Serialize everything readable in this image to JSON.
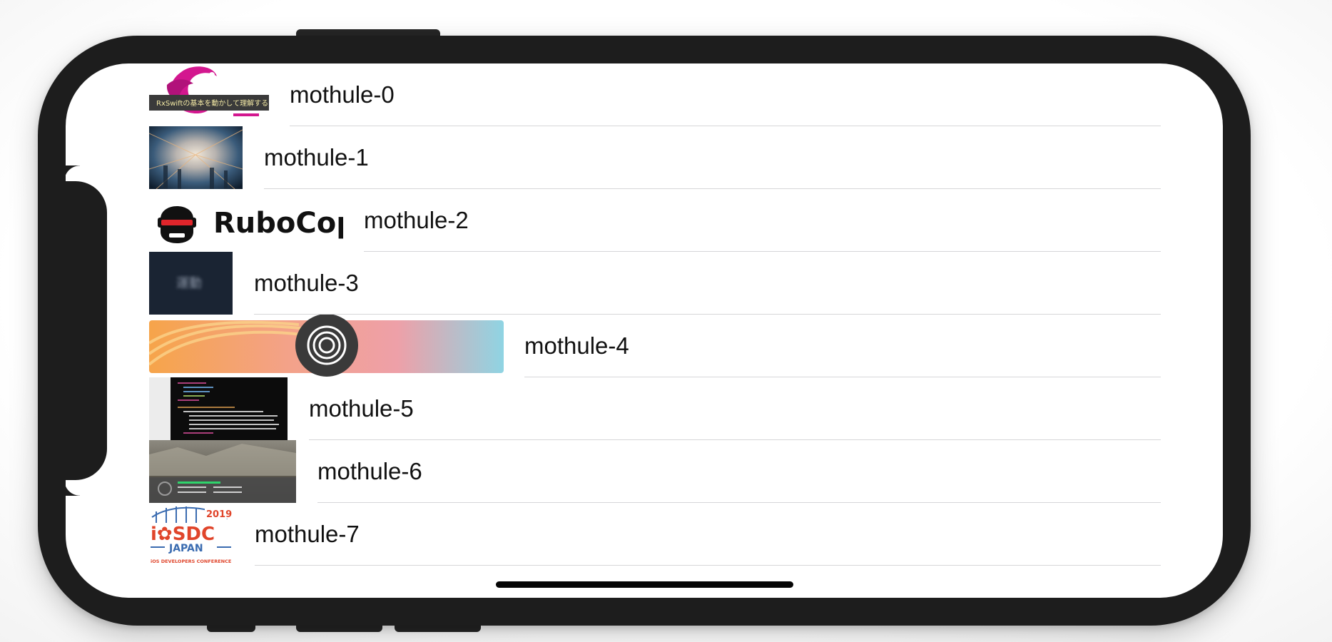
{
  "table": {
    "rows": [
      {
        "label": "mothule-0",
        "thumbnail": "rxswift-banner",
        "thumb_caption": "RxSwiftの基本を動かして理解する"
      },
      {
        "label": "mothule-1",
        "thumbnail": "warp-speed-city-photo"
      },
      {
        "label": "mothule-2",
        "thumbnail": "rubocop-logo",
        "thumb_caption": "RuboCop"
      },
      {
        "label": "mothule-3",
        "thumbnail": "dark-blurred-card",
        "thumb_caption": "運動"
      },
      {
        "label": "mothule-4",
        "thumbnail": "colorful-stadium-with-circle-icon"
      },
      {
        "label": "mothule-5",
        "thumbnail": "code-editor-screenshot"
      },
      {
        "label": "mothule-6",
        "thumbnail": "ruins-video-screenshot"
      },
      {
        "label": "mothule-7",
        "thumbnail": "iosdc-japan-2019-logo",
        "thumb_caption": "2019",
        "thumb_caption2": "JAPAN",
        "thumb_caption3": "iOS DEVELOPERS CONFERENCE"
      }
    ]
  },
  "colors": {
    "device_frame": "#1d1d1d",
    "separator": "#d6d6d8",
    "text": "#111111"
  }
}
